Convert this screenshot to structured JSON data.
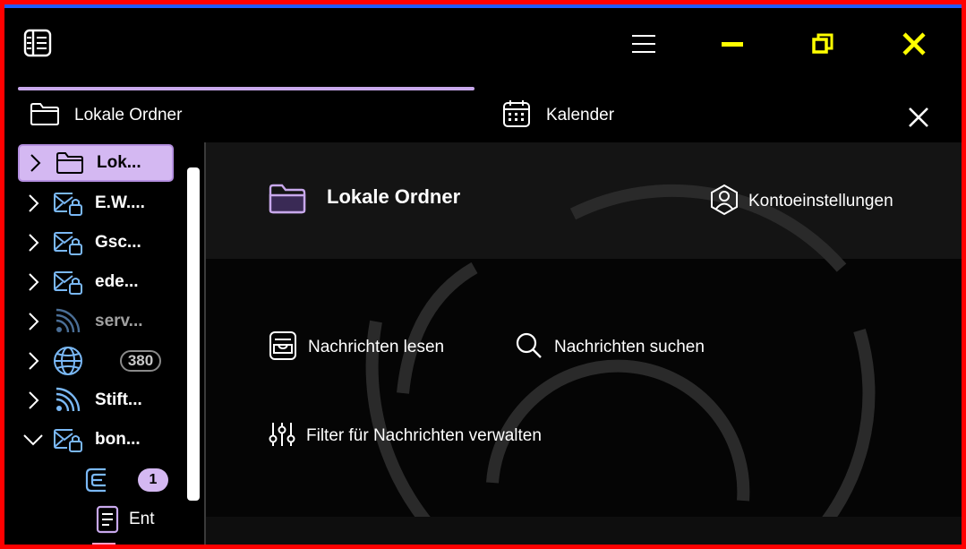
{
  "app": {
    "icon": "address-book-icon"
  },
  "window_controls": {
    "menu_icon": "hamburger-icon",
    "minimize_icon": "minimize-icon",
    "restore_icon": "restore-icon",
    "close_icon": "close-icon",
    "accent_color": "#ffff00"
  },
  "tabs": [
    {
      "label": "Lokale Ordner",
      "icon": "folder-icon",
      "active": true
    },
    {
      "label": "Kalender",
      "icon": "calendar-icon",
      "active": false
    }
  ],
  "tab_close_icon": "close-icon",
  "sidebar": {
    "items": [
      {
        "label": "Lok...",
        "icon": "folder-icon",
        "expanded": false,
        "selected": true
      },
      {
        "label": "E.W....",
        "icon": "mail-lock-icon",
        "expanded": false
      },
      {
        "label": "Gsc...",
        "icon": "mail-lock-icon",
        "expanded": false
      },
      {
        "label": "ede...",
        "icon": "mail-lock-icon",
        "expanded": false
      },
      {
        "label": "serv...",
        "icon": "rss-icon",
        "expanded": false,
        "dimmed": true
      },
      {
        "label": "",
        "icon": "globe-icon",
        "expanded": false,
        "count": "380"
      },
      {
        "label": "Stift...",
        "icon": "rss-icon",
        "expanded": false
      },
      {
        "label": "bon...",
        "icon": "mail-lock-icon",
        "expanded": true
      }
    ],
    "children": [
      {
        "icon": "inbox-icon",
        "unread": "1"
      },
      {
        "label": "Ent",
        "icon": "drafts-icon"
      }
    ],
    "selected_color": "#d4b8f2"
  },
  "main": {
    "account_title": "Lokale Ordner",
    "account_icon": "folder-icon",
    "settings_label": "Kontoeinstellungen",
    "settings_icon": "account-settings-icon",
    "actions": [
      {
        "label": "Nachrichten lesen",
        "icon": "inbox-tray-icon"
      },
      {
        "label": "Nachrichten suchen",
        "icon": "search-icon"
      },
      {
        "label": "Filter für Nachrichten verwalten",
        "icon": "filter-sliders-icon"
      }
    ]
  },
  "colors": {
    "frame": "#ff0000",
    "accent_blue": "#1e5bff",
    "purple": "#c8a8ec",
    "icon_blue": "#7ab8f5"
  }
}
